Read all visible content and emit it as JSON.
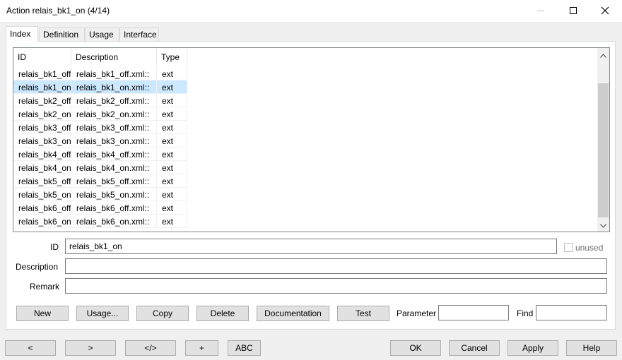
{
  "window": {
    "title": "Action relais_bk1_on (4/14)",
    "minimize_icon": "—",
    "maximize_icon": "☐",
    "close_icon": "✕"
  },
  "tabs": [
    {
      "label": "Index"
    },
    {
      "label": "Definition"
    },
    {
      "label": "Usage"
    },
    {
      "label": "Interface"
    }
  ],
  "table": {
    "columns": [
      "ID",
      "Description",
      "Type"
    ],
    "rows": [
      {
        "id": "relais_bk1_off",
        "description": "relais_bk1_off.xml::",
        "type": "ext"
      },
      {
        "id": "relais_bk1_on",
        "description": "relais_bk1_on.xml::",
        "type": "ext"
      },
      {
        "id": "relais_bk2_off",
        "description": "relais_bk2_off.xml::",
        "type": "ext"
      },
      {
        "id": "relais_bk2_on",
        "description": "relais_bk2_on.xml::",
        "type": "ext"
      },
      {
        "id": "relais_bk3_off",
        "description": "relais_bk3_off.xml::",
        "type": "ext"
      },
      {
        "id": "relais_bk3_on",
        "description": "relais_bk3_on.xml::",
        "type": "ext"
      },
      {
        "id": "relais_bk4_off",
        "description": "relais_bk4_off.xml::",
        "type": "ext"
      },
      {
        "id": "relais_bk4_on",
        "description": "relais_bk4_on.xml::",
        "type": "ext"
      },
      {
        "id": "relais_bk5_off",
        "description": "relais_bk5_off.xml::",
        "type": "ext"
      },
      {
        "id": "relais_bk5_on",
        "description": "relais_bk5_on.xml::",
        "type": "ext"
      },
      {
        "id": "relais_bk6_off",
        "description": "relais_bk6_off.xml::",
        "type": "ext"
      },
      {
        "id": "relais_bk6_on",
        "description": "relais_bk6_on.xml::",
        "type": "ext"
      }
    ],
    "scroll_up_icon": "▲",
    "scroll_down_icon": "▼"
  },
  "form": {
    "id_label": "ID",
    "id_value": "relais_bk1_on",
    "unused_label": "unused",
    "description_label": "Description",
    "description_value": "",
    "remark_label": "Remark",
    "remark_value": ""
  },
  "actions": {
    "new": "New",
    "usage": "Usage...",
    "copy": "Copy",
    "delete": "Delete",
    "documentation": "Documentation",
    "test": "Test",
    "parameter_label": "Parameter",
    "parameter_value": "",
    "find_label": "Find",
    "find_value": ""
  },
  "footer": {
    "prev": "<",
    "next": ">",
    "code": "</>",
    "plus": "+",
    "abc": "ABC",
    "ok": "OK",
    "cancel": "Cancel",
    "apply": "Apply",
    "help": "Help"
  }
}
